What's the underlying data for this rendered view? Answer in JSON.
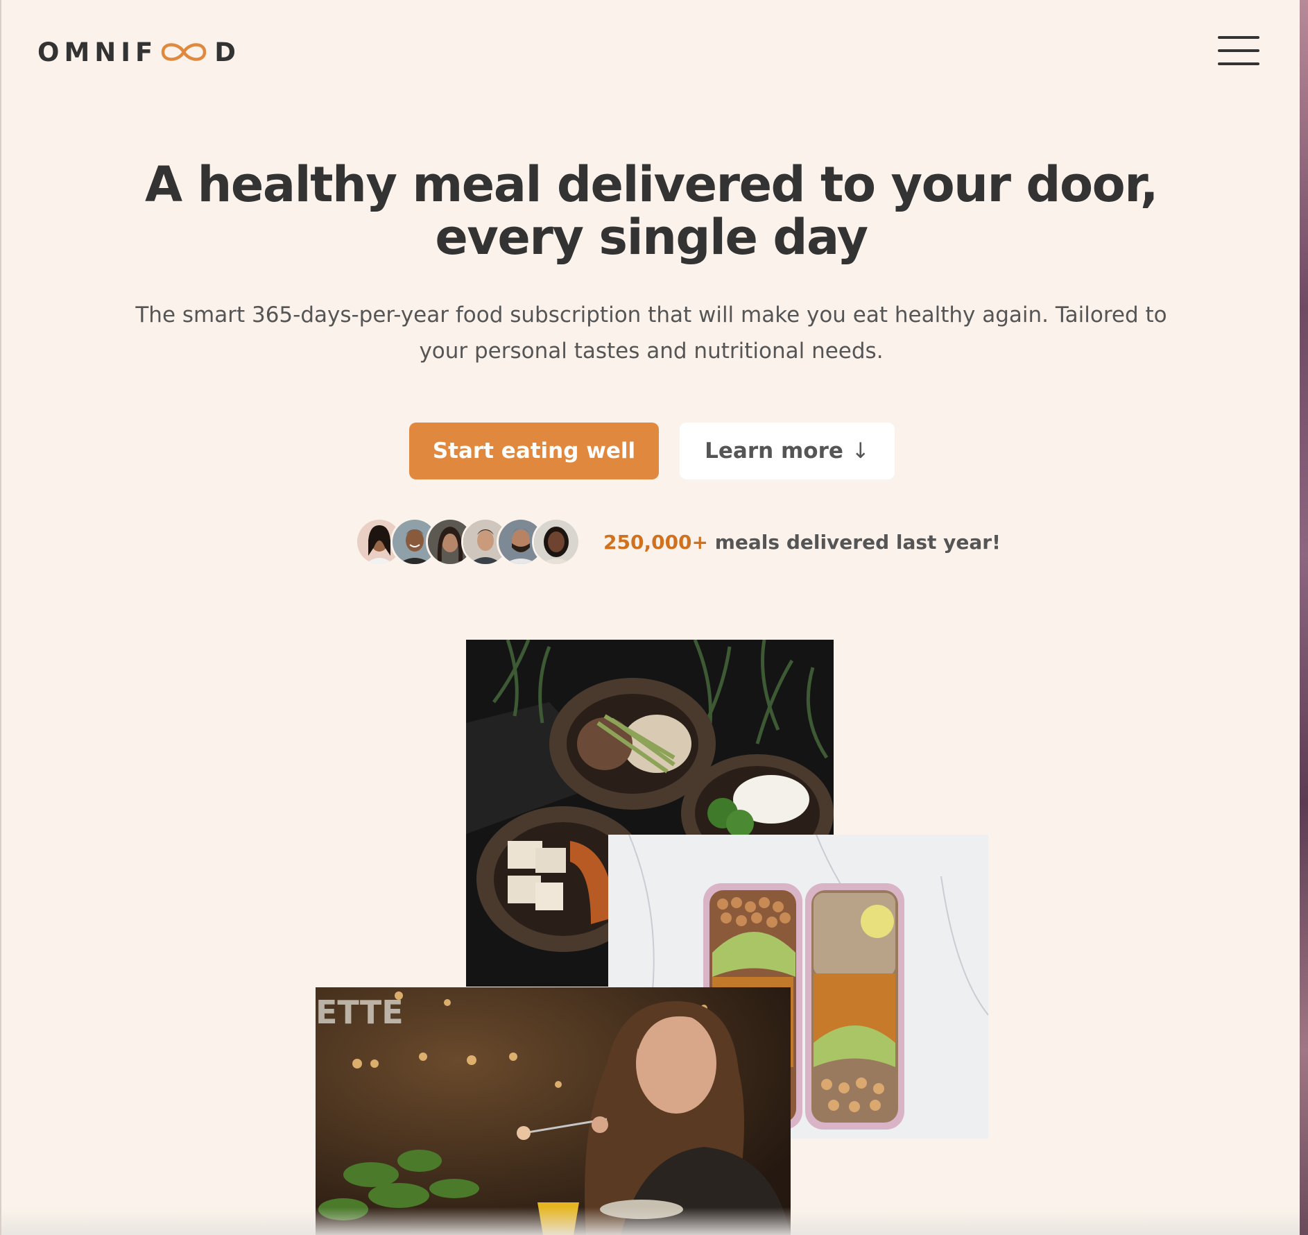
{
  "header": {
    "logo": {
      "text_before": "OMNIF",
      "text_after": "D",
      "icon": "infinity-icon"
    },
    "menu_icon": "hamburger-menu-icon"
  },
  "hero": {
    "title": "A healthy meal delivered to your door, every single day",
    "description": "The smart 365-days-per-year food subscription that will make you eat healthy again. Tailored to your personal tastes and nutritional needs.",
    "primary_button": "Start eating well",
    "secondary_button": "Learn more",
    "secondary_icon": "arrow-down-icon",
    "delivered_count": "250,000+",
    "delivered_text": " meals delivered last year!",
    "customer_avatars": [
      "customer-1",
      "customer-2",
      "customer-3",
      "customer-4",
      "customer-5",
      "customer-6"
    ]
  },
  "colors": {
    "page_background": "#fbf3eb",
    "brand": "#e0883e",
    "brand_dark": "#cf711f",
    "text_dark": "#333333",
    "text_body": "#555555"
  }
}
